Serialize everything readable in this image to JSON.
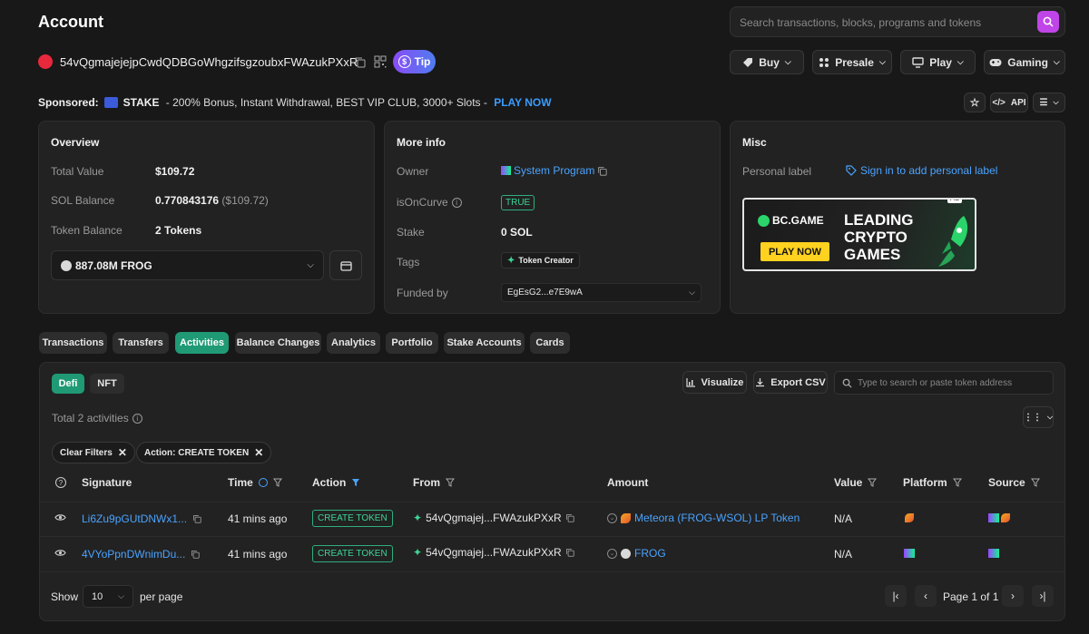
{
  "header": {
    "title": "Account",
    "search_placeholder": "Search transactions, blocks, programs and tokens",
    "address": "54vQgmajejejpCwdQDBGoWhgzifsgzoubxFWAzukPXxR",
    "tip_label": "Tip",
    "menus": [
      {
        "label": "Buy",
        "icon": "cart-icon"
      },
      {
        "label": "Presale",
        "icon": "dots-icon"
      },
      {
        "label": "Play",
        "icon": "screen-icon"
      },
      {
        "label": "Gaming",
        "icon": "gamepad-icon"
      }
    ]
  },
  "sponsored": {
    "prefix": "Sponsored:",
    "brand": "STAKE",
    "text": " - 200% Bonus, Instant Withdrawal, BEST VIP CLUB, 3000+ Slots - ",
    "cta": "PLAY NOW",
    "api_label": "API"
  },
  "overview": {
    "title": "Overview",
    "total_value_label": "Total Value",
    "total_value": "$109.72",
    "sol_balance_label": "SOL Balance",
    "sol_balance": "0.770843176",
    "sol_balance_usd": "($109.72)",
    "token_balance_label": "Token Balance",
    "token_balance": "2 Tokens",
    "token_select": "887.08M FROG"
  },
  "more_info": {
    "title": "More info",
    "owner_label": "Owner",
    "owner": "System Program",
    "oncurve_label": "isOnCurve",
    "oncurve": "TRUE",
    "stake_label": "Stake",
    "stake": "0 SOL",
    "tags_label": "Tags",
    "tag": "Token Creator",
    "funded_label": "Funded by",
    "funded": "EgEsG2...e7E9wA"
  },
  "misc": {
    "title": "Misc",
    "personal_label": "Personal label",
    "sign_in": "Sign in to add personal label",
    "ad_badge": "Ad",
    "ad_brand": "BC.GAME",
    "ad_cta": "PLAY NOW",
    "ad_line1": "LEADING",
    "ad_line2": "CRYPTO",
    "ad_line3": "GAMES"
  },
  "tabs": [
    "Transactions",
    "Transfers",
    "Activities",
    "Balance Changes",
    "Analytics",
    "Portfolio",
    "Stake Accounts",
    "Cards"
  ],
  "activities": {
    "subtabs": [
      "Defi",
      "NFT"
    ],
    "visualize": "Visualize",
    "export": "Export CSV",
    "token_search_placeholder": "Type to search or paste token address",
    "total": "Total 2 activities",
    "clear_filters": "Clear Filters",
    "action_filter": "Action: CREATE TOKEN",
    "columns": [
      "Signature",
      "Time",
      "Action",
      "From",
      "Amount",
      "Value",
      "Platform",
      "Source"
    ],
    "rows": [
      {
        "signature": "Li6Zu9pGUtDNWx1...",
        "time": "41 mins ago",
        "action": "CREATE TOKEN",
        "from": "54vQgmajej...FWAzukPXxR",
        "amount": "Meteora (FROG-WSOL) LP Token",
        "value": "N/A"
      },
      {
        "signature": "4VYoPpnDWnimDu...",
        "time": "41 mins ago",
        "action": "CREATE TOKEN",
        "from": "54vQgmajej...FWAzukPXxR",
        "amount": "FROG",
        "value": "N/A"
      }
    ],
    "show_label": "Show",
    "page_size": "10",
    "per_page": "per page",
    "page_info": "Page 1 of 1"
  },
  "colors": {
    "accent": "#1f9a74",
    "link": "#4aa3ff",
    "tip": "#a259ff",
    "search_btn": "#c045e8"
  }
}
